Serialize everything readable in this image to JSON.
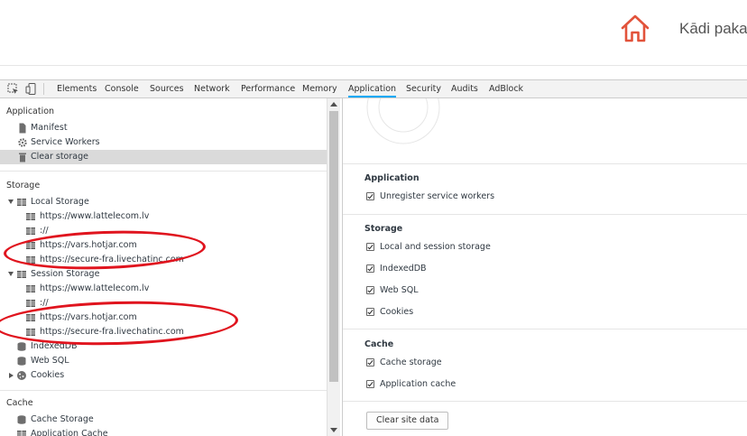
{
  "site": {
    "title": "Kādi paka"
  },
  "devtools": {
    "tabs": [
      "Elements",
      "Console",
      "Sources",
      "Network",
      "Performance",
      "Memory",
      "Application",
      "Security",
      "Audits",
      "AdBlock"
    ],
    "active_tab": "Application",
    "accent_color": "#03a9f4"
  },
  "sidebar": {
    "application": {
      "title": "Application",
      "items": [
        {
          "label": "Manifest",
          "icon": "file-icon"
        },
        {
          "label": "Service Workers",
          "icon": "gear-icon"
        },
        {
          "label": "Clear storage",
          "icon": "trash-icon",
          "selected": true
        }
      ]
    },
    "storage": {
      "title": "Storage",
      "local_storage": {
        "label": "Local Storage",
        "origins": [
          "https://www.lattelecom.lv",
          "://",
          "https://vars.hotjar.com",
          "https://secure-fra.livechatinc.com"
        ]
      },
      "session_storage": {
        "label": "Session Storage",
        "origins": [
          "https://www.lattelecom.lv",
          "://",
          "https://vars.hotjar.com",
          "https://secure-fra.livechatinc.com"
        ]
      },
      "indexeddb": "IndexedDB",
      "websql": "Web SQL",
      "cookies": "Cookies"
    },
    "cache": {
      "title": "Cache",
      "cache_storage": "Cache Storage",
      "application_cache": "Application Cache"
    }
  },
  "clear_storage": {
    "application": {
      "title": "Application",
      "options": [
        {
          "label": "Unregister service workers",
          "checked": true
        }
      ]
    },
    "storage": {
      "title": "Storage",
      "options": [
        {
          "label": "Local and session storage",
          "checked": true
        },
        {
          "label": "IndexedDB",
          "checked": true
        },
        {
          "label": "Web SQL",
          "checked": true
        },
        {
          "label": "Cookies",
          "checked": true
        }
      ]
    },
    "cache": {
      "title": "Cache",
      "options": [
        {
          "label": "Cache storage",
          "checked": true
        },
        {
          "label": "Application cache",
          "checked": true
        }
      ]
    },
    "button_label": "Clear site data"
  },
  "annotation_color": "#e0141e"
}
